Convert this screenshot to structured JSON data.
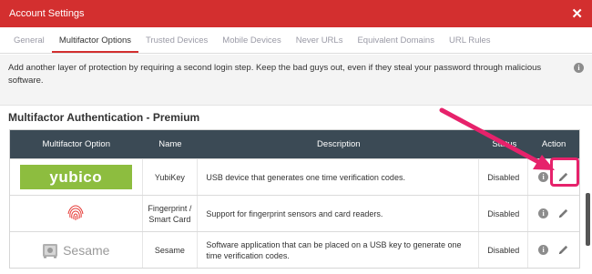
{
  "titlebar": {
    "title": "Account Settings",
    "close_glyph": "✕"
  },
  "tabs": [
    {
      "label": "General",
      "active": false
    },
    {
      "label": "Multifactor Options",
      "active": true
    },
    {
      "label": "Trusted Devices",
      "active": false
    },
    {
      "label": "Mobile Devices",
      "active": false
    },
    {
      "label": "Never URLs",
      "active": false
    },
    {
      "label": "Equivalent Domains",
      "active": false
    },
    {
      "label": "URL Rules",
      "active": false
    }
  ],
  "info": {
    "text": "Add another layer of protection by requiring a second login step. Keep the bad guys out, even if they steal your password through malicious software.",
    "icon": "info-icon"
  },
  "section": {
    "title": "Multifactor Authentication - Premium"
  },
  "table": {
    "headers": [
      "Multifactor Option",
      "Name",
      "Description",
      "Status",
      "Action"
    ],
    "rows": [
      {
        "logo": "yubico",
        "logo_text": "yubico",
        "name": "YubiKey",
        "description": "USB device that generates one time verification codes.",
        "status": "Disabled"
      },
      {
        "logo": "fingerprint",
        "logo_text": "",
        "name": "Fingerprint / Smart Card",
        "description": "Support for fingerprint sensors and card readers.",
        "status": "Disabled"
      },
      {
        "logo": "sesame",
        "logo_text": "Sesame",
        "name": "Sesame",
        "description": "Software application that can be placed on a USB key to generate one time verification codes.",
        "status": "Disabled"
      }
    ]
  },
  "colors": {
    "titlebar": "#d32f2f",
    "header": "#3b4a55",
    "yubico": "#8dbd3f",
    "highlight": "#e6226b",
    "active_tab_underline": "#d32f2f"
  }
}
